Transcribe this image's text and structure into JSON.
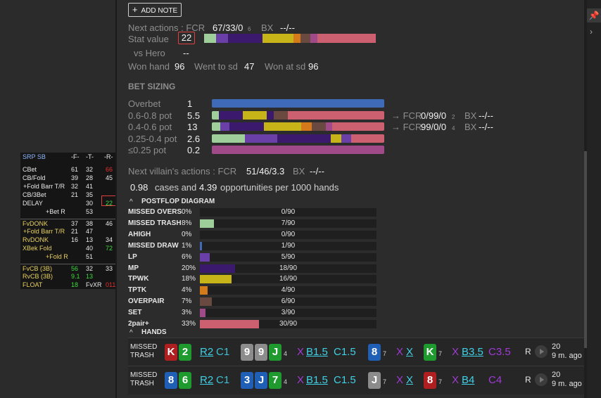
{
  "hud": {
    "title": "SRP SB",
    "col_f": "-F-",
    "col_t": "-T-",
    "col_r": "-R-",
    "rows": [
      {
        "label": "CBet",
        "f": "61",
        "t": "32",
        "r": "66"
      },
      {
        "label": "CB/Fold",
        "f": "39",
        "t": "28",
        "r": "45"
      },
      {
        "label": "+Fold  Barr T/R",
        "f": "32",
        "t": "41",
        "r": ""
      },
      {
        "label": "CB/3Bet",
        "f": "21",
        "t": "35",
        "r": ""
      },
      {
        "label": "DELAY",
        "f": "",
        "t": "30",
        "r": "22"
      },
      {
        "label": "+Bet R",
        "f": "",
        "t": "53",
        "r": ""
      },
      {
        "label": "FvDONK",
        "f": "37",
        "t": "38",
        "r": "46"
      },
      {
        "label": "+Fold Barr T/R",
        "f": "21",
        "t": "47",
        "r": ""
      },
      {
        "label": "RvDONK",
        "f": "16",
        "t": "13",
        "r": "34"
      },
      {
        "label": "XBek Fold",
        "f": "",
        "t": "40",
        "r": "72"
      },
      {
        "label": "+Fold R",
        "f": "",
        "t": "51",
        "r": ""
      },
      {
        "label": "FvCB (3B)",
        "f": "56",
        "t": "32",
        "r": "33"
      },
      {
        "label": "RvCB (3B)",
        "f": "9.1",
        "t": "13",
        "r": ""
      },
      {
        "label": "FLOAT",
        "f": "18",
        "t": "FvXR",
        "r": "011"
      }
    ]
  },
  "add_note_label": "ADD NOTE",
  "next_actions_label": "Next actions : FCR",
  "next_actions_value": "67/33/0",
  "next_actions_count": "6",
  "next_actions_bx_label": "BX",
  "next_actions_bx_value": "--/--",
  "stat_value_label": "Stat value",
  "stat_value": "22",
  "stat_bar": [
    0.07,
    0.07,
    0.2,
    0.18,
    0.04,
    0.06,
    0.04,
    0.34
  ],
  "vs_hero_label": "vs Hero",
  "vs_hero_value": "--",
  "won_hand_label": "Won hand",
  "won_hand_value": "96",
  "went_sd_label": "Went to sd",
  "went_sd_value": "47",
  "won_sd_label": "Won at sd",
  "won_sd_value": "96",
  "bet_sizing_title": "BET SIZING",
  "bet_sizing": [
    {
      "label": "Overbet",
      "value": "1",
      "next": "",
      "next_count": "",
      "bx": "",
      "bx_value": ""
    },
    {
      "label": "0.6-0.8 pot",
      "value": "5.5",
      "next": "→ FCR",
      "next_value": "0/99/0",
      "next_count": "2",
      "bx": "BX",
      "bx_value": "--/--"
    },
    {
      "label": "0.4-0.6 pot",
      "value": "13",
      "next": "→ FCR",
      "next_value": "99/0/0",
      "next_count": "4",
      "bx": "BX",
      "bx_value": "--/--"
    },
    {
      "label": "0.25-0.4 pot",
      "value": "2.6",
      "next": "",
      "next_value": "",
      "next_count": "",
      "bx": "",
      "bx_value": ""
    },
    {
      "label": "≤0.25 pot",
      "value": "0.2",
      "next": "",
      "next_value": "",
      "next_count": "",
      "bx": "",
      "bx_value": ""
    }
  ],
  "next_villain_label": "Next villain's actions :  FCR",
  "next_villain_value": "51/46/3.3",
  "next_villain_bx_label": "BX",
  "next_villain_bx_value": "--/--",
  "cases_value": "0.98",
  "cases_label": "cases and",
  "opps_value": "4.39",
  "opps_label": "opportunities per 1000 hands",
  "postflop_title": "POSTFLOP DIAGRAM",
  "postflop": [
    {
      "label": "MISSED OVERS",
      "pct": "0%",
      "count": "0/90",
      "frac": 0.0,
      "color": "#9ecf9a"
    },
    {
      "label": "MISSED TRASH",
      "pct": "8%",
      "count": "7/90",
      "frac": 0.078,
      "color": "#9ecf9a"
    },
    {
      "label": "AHIGH",
      "pct": "0%",
      "count": "0/90",
      "frac": 0.0,
      "color": "#9ecf9a"
    },
    {
      "label": "MISSED DRAW",
      "pct": "1%",
      "count": "1/90",
      "frac": 0.011,
      "color": "#3e6ab8"
    },
    {
      "label": "LP",
      "pct": "6%",
      "count": "5/90",
      "frac": 0.056,
      "color": "#6a3fa8"
    },
    {
      "label": "MP",
      "pct": "20%",
      "count": "18/90",
      "frac": 0.2,
      "color": "#3b1a6e"
    },
    {
      "label": "TPWK",
      "pct": "18%",
      "count": "16/90",
      "frac": 0.178,
      "color": "#c6b418"
    },
    {
      "label": "TPTK",
      "pct": "4%",
      "count": "4/90",
      "frac": 0.044,
      "color": "#d57a1a"
    },
    {
      "label": "OVERPAIR",
      "pct": "7%",
      "count": "6/90",
      "frac": 0.067,
      "color": "#6a4a40"
    },
    {
      "label": "SET",
      "pct": "3%",
      "count": "3/90",
      "frac": 0.033,
      "color": "#a14a8a"
    },
    {
      "label": "2pair+",
      "pct": "33%",
      "count": "30/90",
      "frac": 0.333,
      "color": "#cc6070"
    }
  ],
  "hands_title": "HANDS",
  "hands": [
    {
      "label1": "MISSED",
      "label2": "TRASH",
      "hole": [
        {
          "rank": "K",
          "suit": "red"
        },
        {
          "rank": "2",
          "suit": "green"
        }
      ],
      "pre": "R2",
      "pre2": "C1",
      "flop": [
        {
          "rank": "9",
          "suit": "gray"
        },
        {
          "rank": "9",
          "suit": "gray"
        },
        {
          "rank": "J",
          "suit": "green"
        }
      ],
      "flop_count": "4",
      "flop_act": "X",
      "flop_bet": "B1.5",
      "flop_call": "C1.5",
      "turn": {
        "rank": "8",
        "suit": "blue"
      },
      "turn_count": "7",
      "turn_act": "X",
      "turn_act2": "X",
      "river": {
        "rank": "K",
        "suit": "green"
      },
      "river_count": "7",
      "river_act": "X",
      "river_bet": "B3.5",
      "river_call": "C3.5",
      "pos": "R",
      "time1": "20",
      "time2": "9 m. ago"
    },
    {
      "label1": "MISSED",
      "label2": "TRASH",
      "hole": [
        {
          "rank": "8",
          "suit": "blue"
        },
        {
          "rank": "6",
          "suit": "green"
        }
      ],
      "pre": "R2",
      "pre2": "C1",
      "flop": [
        {
          "rank": "3",
          "suit": "blue"
        },
        {
          "rank": "J",
          "suit": "blue"
        },
        {
          "rank": "7",
          "suit": "green"
        }
      ],
      "flop_count": "4",
      "flop_act": "X",
      "flop_bet": "B1.5",
      "flop_call": "C1.5",
      "turn": {
        "rank": "J",
        "suit": "gray"
      },
      "turn_count": "7",
      "turn_act": "X",
      "turn_act2": "X",
      "river": {
        "rank": "8",
        "suit": "red"
      },
      "river_count": "7",
      "river_act": "X",
      "river_bet": "B4",
      "river_call": "C4",
      "pos": "R",
      "time1": "20",
      "time2": "9 m. ago"
    }
  ],
  "bet_bars": {
    "overbet": [
      [
        1.0,
        "#3e6ab8"
      ]
    ],
    "b68": [
      [
        0.04,
        "#9ecf9a"
      ],
      [
        0.14,
        "#3b1a6e"
      ],
      [
        0.14,
        "#c6b418"
      ],
      [
        0.04,
        "#3b1a6e"
      ],
      [
        0.08,
        "#6a4a40"
      ],
      [
        0.56,
        "#cc6070"
      ]
    ],
    "b46": [
      [
        0.05,
        "#9ecf9a"
      ],
      [
        0.05,
        "#6a3fa8"
      ],
      [
        0.2,
        "#3b1a6e"
      ],
      [
        0.22,
        "#c6b418"
      ],
      [
        0.06,
        "#d57a1a"
      ],
      [
        0.08,
        "#6a4a40"
      ],
      [
        0.04,
        "#a14a8a"
      ],
      [
        0.3,
        "#cc6070"
      ]
    ],
    "b254": [
      [
        0.19,
        "#9ecf9a"
      ],
      [
        0.19,
        "#6a3fa8"
      ],
      [
        0.31,
        "#3b1a6e"
      ],
      [
        0.06,
        "#c6b418"
      ],
      [
        0.06,
        "#6a3fa8"
      ],
      [
        0.19,
        "#cc6070"
      ]
    ],
    "b025": [
      [
        1.0,
        "#a14a8a"
      ]
    ]
  },
  "colors": {
    "stat_bar": [
      "#9ecf9a",
      "#6a3fa8",
      "#3b1a6e",
      "#c6b418",
      "#d57a1a",
      "#6a4a40",
      "#a14a8a",
      "#cc6070"
    ]
  },
  "icons": {
    "pin": "pin-icon",
    "chevron": "chevron-right-icon",
    "plus": "plus-icon",
    "play": "play-icon"
  }
}
